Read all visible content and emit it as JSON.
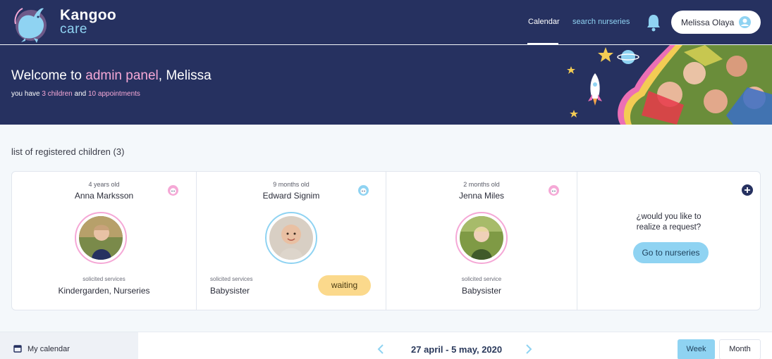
{
  "header": {
    "brand_line1": "Kangoo",
    "brand_line2": "care",
    "nav": {
      "calendar": "Calendar",
      "search": "search nurseries"
    },
    "user_name": "Melissa Olaya",
    "icons": {
      "logo": "kangaroo-logo",
      "bell": "bell-icon",
      "avatar": "user-avatar-icon"
    }
  },
  "hero": {
    "title_prefix": "Welcome to ",
    "title_accent": "admin panel",
    "title_suffix": ", Melissa",
    "sub_prefix": "you have ",
    "sub_children": "3 children",
    "sub_mid": " and ",
    "sub_appointments": "10 appointments"
  },
  "section": {
    "title": "list of registered children (3)"
  },
  "children": [
    {
      "age": "4 years old",
      "name": "Anna Marksson",
      "service_label": "solicited services",
      "service": "Kindergarden, Nurseries",
      "icon": "girl-face-icon"
    },
    {
      "age": "9 months old",
      "name": "Edward Signim",
      "service_label": "solicited services",
      "service": "Babysister",
      "status": "waiting",
      "icon": "boy-face-icon"
    },
    {
      "age": "2 months old",
      "name": "Jenna Miles",
      "service_label": "solicited service",
      "service": "Babysister",
      "icon": "girl-face-icon"
    }
  ],
  "request": {
    "line1": "¿would you like to",
    "line2": "realize a request?",
    "button": "Go to nurseries",
    "icon": "plus-circle-icon"
  },
  "calendar": {
    "label": "My calendar",
    "range": "27 april - 5 may, 2020",
    "week": "Week",
    "month": "Month"
  },
  "colors": {
    "navy": "#263160",
    "pink_accent": "#f5a8d6",
    "sky": "#8fd3f2",
    "waiting": "#fbd98c"
  }
}
